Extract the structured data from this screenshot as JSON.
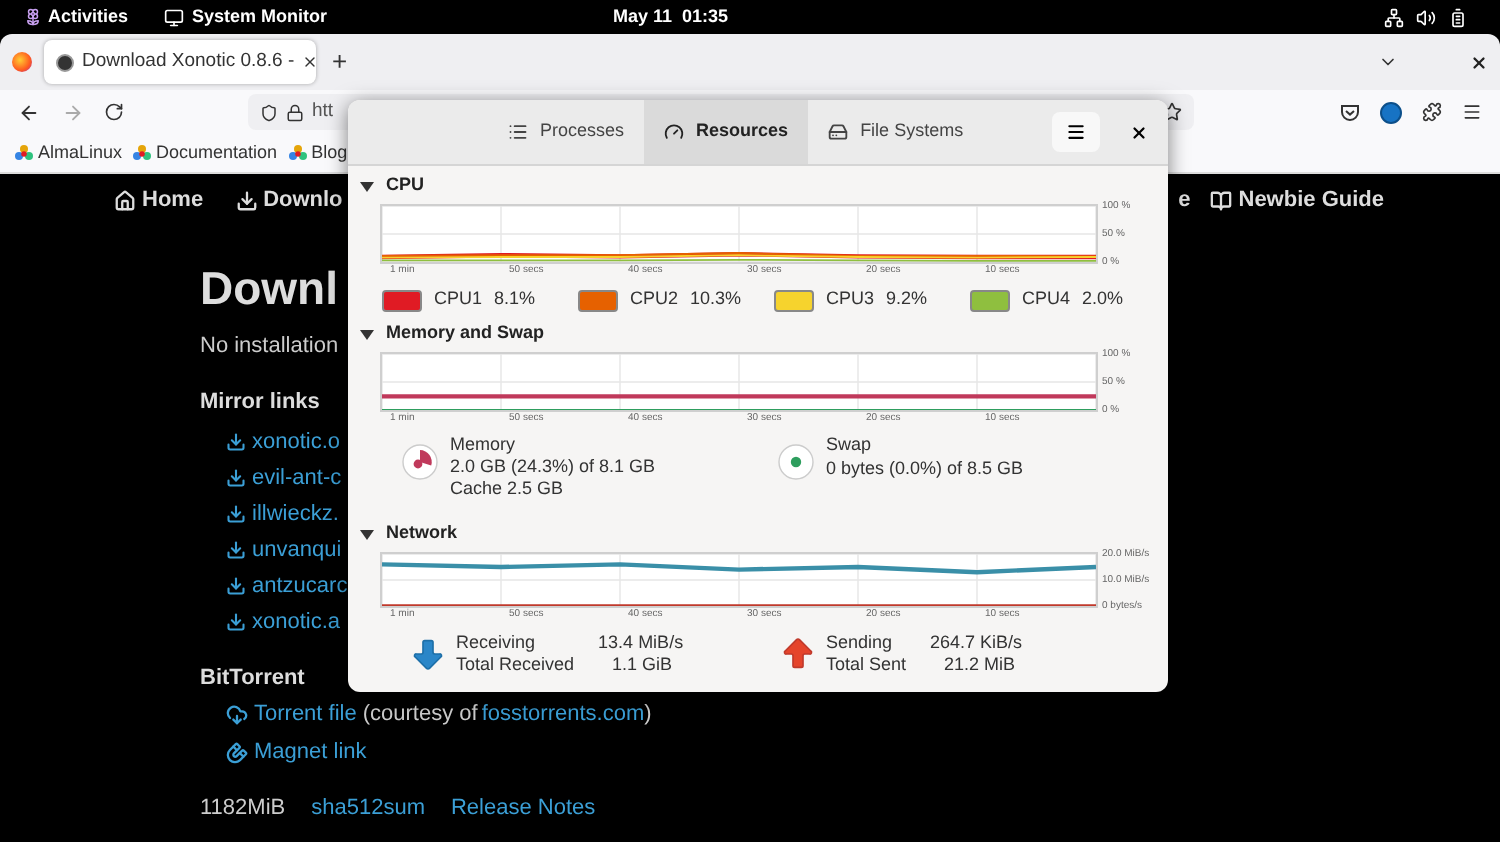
{
  "top_bar": {
    "activities": "Activities",
    "app": "System Monitor",
    "clock": "May 11  01:35"
  },
  "browser": {
    "tabs": [
      {
        "title": "Download Xonotic 0.8.6 -",
        "selected": true
      }
    ],
    "new_tab": "+",
    "url": "htt",
    "bookmarks": [
      "AlmaLinux",
      "Documentation",
      "Blog"
    ]
  },
  "page": {
    "nav": [
      {
        "kind": "home",
        "label": "Home"
      },
      {
        "kind": "download",
        "label": "Downlo"
      },
      {
        "kind": "text",
        "label": "e"
      },
      {
        "kind": "guide",
        "label": "Newbie Guide"
      }
    ],
    "heading": "Downl",
    "intro": "No installation",
    "mirror_title": "Mirror links",
    "mirrors": [
      "xonotic.o",
      "evil-ant-c",
      "illwieckz.",
      "unvanqui",
      "antzucarc",
      "xonotic.a"
    ],
    "bittorrent_title": "BitTorrent",
    "torrent": {
      "link": "Torrent file",
      "before": "(courtesy of",
      "site": "fosstorrents.com",
      "after": ")"
    },
    "magnet": "Magnet link",
    "footer": {
      "size": "1182MiB",
      "links": [
        "sha512sum",
        "Release Notes"
      ]
    }
  },
  "monitor": {
    "tabs": [
      {
        "kind": "processes",
        "label": "Processes",
        "selected": false
      },
      {
        "kind": "resources",
        "label": "Resources",
        "selected": true
      },
      {
        "kind": "filesystems",
        "label": "File Systems",
        "selected": false
      }
    ],
    "cpu": {
      "title": "CPU",
      "expanded": true,
      "chart_data": {
        "type": "line",
        "categories": [
          "1 min",
          "50 secs",
          "40 secs",
          "30 secs",
          "20 secs",
          "10 secs",
          null
        ],
        "ylim": [
          0,
          100
        ],
        "yticks": [
          {
            "value": 100,
            "label": "100 %"
          },
          {
            "value": 50,
            "label": "50 %"
          },
          {
            "value": 0,
            "label": "0 %"
          }
        ],
        "series": [
          {
            "name": "CPU1",
            "color": "#e01b24",
            "values": [
              9,
              12,
              10,
              14,
              10,
              9,
              9
            ]
          },
          {
            "name": "CPU2",
            "color": "#e66100",
            "values": [
              11,
              12,
              12,
              16,
              11,
              11,
              10
            ]
          },
          {
            "name": "CPU3",
            "color": "#f6d32d",
            "values": [
              8,
              9,
              9,
              12,
              9,
              8,
              9
            ]
          },
          {
            "name": "CPU4",
            "color": "#8fbf3f",
            "values": [
              3,
              3,
              3,
              4,
              3,
              2,
              2
            ]
          }
        ]
      },
      "legend": [
        {
          "value": "8.1%"
        },
        {
          "value": "10.3%"
        },
        {
          "value": "9.2%"
        },
        {
          "value": "2.0%"
        }
      ]
    },
    "memory": {
      "title": "Memory and Swap",
      "expanded": true,
      "chart_data": {
        "type": "line",
        "categories": [
          "1 min",
          "50 secs",
          "40 secs",
          "30 secs",
          "20 secs",
          "10 secs",
          null
        ],
        "ylim": [
          0,
          100
        ],
        "yticks": [
          {
            "value": 100,
            "label": "100 %"
          },
          {
            "value": 50,
            "label": "50 %"
          },
          {
            "value": 0,
            "label": "0 %"
          }
        ],
        "series": [
          {
            "name": "Memory",
            "color": "#c0395b",
            "values": [
              24.3,
              24.3,
              24.3,
              24.3,
              24.3,
              24.3,
              24.3
            ]
          },
          {
            "name": "Swap",
            "color": "#2e9e5e",
            "values": [
              0,
              0,
              0,
              0,
              0,
              0,
              0
            ]
          }
        ]
      },
      "memory_usage": "2.0 GB (24.3%) of 8.1 GB",
      "cache": "Cache 2.5 GB",
      "swap_usage": "0 bytes (0.0%) of 8.5 GB"
    },
    "network": {
      "title": "Network",
      "expanded": true,
      "chart_data": {
        "type": "line",
        "categories": [
          "1 min",
          "50 secs",
          "40 secs",
          "30 secs",
          "20 secs",
          "10 secs",
          null
        ],
        "ylim": [
          0,
          20
        ],
        "yticks": [
          {
            "value": 20,
            "label": "20.0 MiB/s"
          },
          {
            "value": 10,
            "label": "10.0 MiB/s"
          },
          {
            "value": 0,
            "label": "0 bytes/s"
          }
        ],
        "series": [
          {
            "name": "Receiving",
            "color": "#3a8fa8",
            "values": [
              16,
              15,
              16,
              14,
              15,
              13,
              15
            ]
          },
          {
            "name": "Sending",
            "color": "#c0392b",
            "values": [
              0.3,
              0.3,
              0.3,
              0.3,
              0.3,
              0.3,
              0.3
            ]
          }
        ]
      },
      "receiving_rate": "13.4 MiB/s",
      "total_received": {
        "label": "Total Received",
        "value": "1.1 GiB"
      },
      "sending_rate": "264.7 KiB/s",
      "total_sent": {
        "label": "Total Sent",
        "value": "21.2 MiB"
      }
    }
  }
}
